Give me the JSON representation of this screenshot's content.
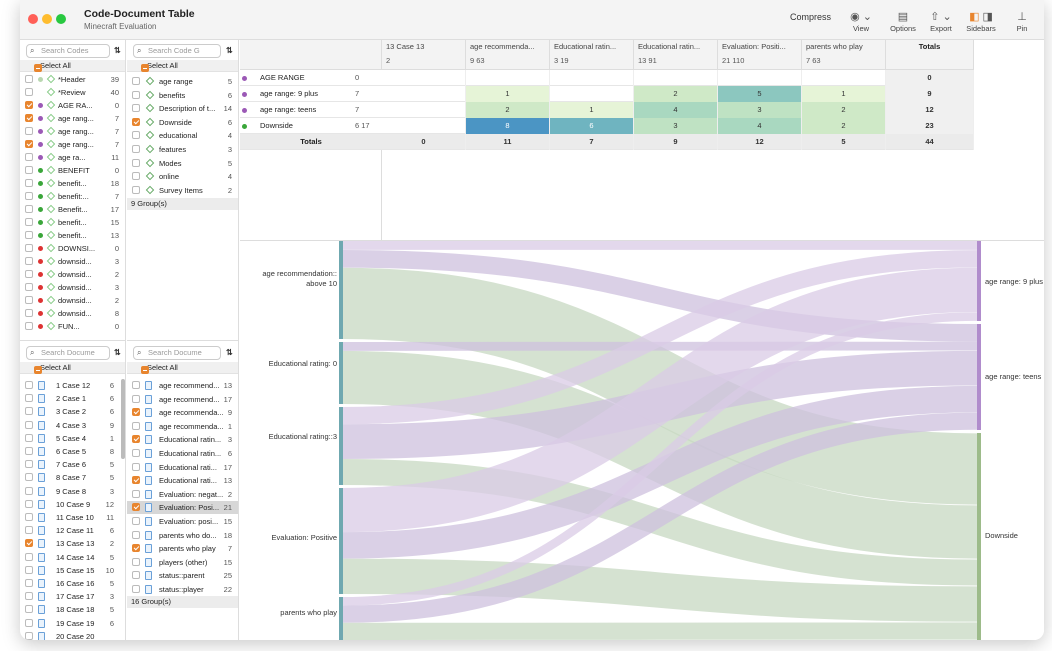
{
  "window": {
    "title": "Code-Document Table",
    "subtitle": "Minecraft Evaluation"
  },
  "toolbar": {
    "compress": "Compress",
    "view": "View",
    "options": "Options",
    "export": "Export",
    "sidebars": "Sidebars",
    "pin": "Pin"
  },
  "codes_panel": {
    "search_placeholder": "Search Codes",
    "select_all": "Select All",
    "items": [
      {
        "label": "*Header",
        "count": "39",
        "color": "#b9d7b0",
        "checked": false
      },
      {
        "label": "*Review",
        "count": "40",
        "color": "",
        "checked": false
      },
      {
        "label": "AGE RA...",
        "count": "0",
        "color": "#9b59b6",
        "checked": true
      },
      {
        "label": "age rang...",
        "count": "7",
        "color": "#9b59b6",
        "checked": true
      },
      {
        "label": "age rang...",
        "count": "7",
        "color": "#9b59b6",
        "checked": false
      },
      {
        "label": "age rang...",
        "count": "7",
        "color": "#9b59b6",
        "checked": true
      },
      {
        "label": "age ra...",
        "count": "11",
        "color": "#9b59b6",
        "checked": false
      },
      {
        "label": "BENEFIT",
        "count": "0",
        "color": "#3aa63a",
        "checked": false
      },
      {
        "label": "benefit...",
        "count": "18",
        "color": "#3aa63a",
        "checked": false
      },
      {
        "label": "benefit:...",
        "count": "7",
        "color": "#3aa63a",
        "checked": false
      },
      {
        "label": "Benefit...",
        "count": "17",
        "color": "#3aa63a",
        "checked": false
      },
      {
        "label": "benefit...",
        "count": "15",
        "color": "#3aa63a",
        "checked": false
      },
      {
        "label": "benefit...",
        "count": "13",
        "color": "#3aa63a",
        "checked": false
      },
      {
        "label": "DOWNSI...",
        "count": "0",
        "color": "#d33",
        "checked": false
      },
      {
        "label": "downsid...",
        "count": "3",
        "color": "#d33",
        "checked": false
      },
      {
        "label": "downsid...",
        "count": "2",
        "color": "#d33",
        "checked": false
      },
      {
        "label": "downsid...",
        "count": "3",
        "color": "#d33",
        "checked": false
      },
      {
        "label": "downsid...",
        "count": "2",
        "color": "#d33",
        "checked": false
      },
      {
        "label": "downsid...",
        "count": "8",
        "color": "#d33",
        "checked": false
      },
      {
        "label": "FUN...",
        "count": "0",
        "color": "#d33",
        "checked": false
      }
    ]
  },
  "code_groups_panel": {
    "search_placeholder": "Search Code G",
    "select_all": "Select All",
    "items": [
      {
        "label": "age range",
        "count": "5",
        "checked": false
      },
      {
        "label": "benefits",
        "count": "6",
        "checked": false
      },
      {
        "label": "Description of t...",
        "count": "14",
        "checked": false
      },
      {
        "label": "Downside",
        "count": "6",
        "checked": true
      },
      {
        "label": "educational",
        "count": "4",
        "checked": false
      },
      {
        "label": "features",
        "count": "3",
        "checked": false
      },
      {
        "label": "Modes",
        "count": "5",
        "checked": false
      },
      {
        "label": "online",
        "count": "4",
        "checked": false
      },
      {
        "label": "Survey Items",
        "count": "2",
        "checked": false
      }
    ],
    "footer": "9 Group(s)"
  },
  "documents_panel": {
    "search_placeholder": "Search Docume",
    "select_all": "Select All",
    "items": [
      {
        "label": "1 Case 12",
        "count": "6",
        "checked": false
      },
      {
        "label": "2 Case 1",
        "count": "6",
        "checked": false
      },
      {
        "label": "3 Case 2",
        "count": "6",
        "checked": false
      },
      {
        "label": "4 Case 3",
        "count": "9",
        "checked": false
      },
      {
        "label": "5 Case 4",
        "count": "1",
        "checked": false
      },
      {
        "label": "6 Case 5",
        "count": "8",
        "checked": false
      },
      {
        "label": "7 Case 6",
        "count": "5",
        "checked": false
      },
      {
        "label": "8 Case 7",
        "count": "5",
        "checked": false
      },
      {
        "label": "9 Case 8",
        "count": "3",
        "checked": false
      },
      {
        "label": "10 Case 9",
        "count": "12",
        "checked": false
      },
      {
        "label": "11 Case 10",
        "count": "11",
        "checked": false
      },
      {
        "label": "12 Case 11",
        "count": "6",
        "checked": false
      },
      {
        "label": "13 Case 13",
        "count": "2",
        "checked": true
      },
      {
        "label": "14 Case 14",
        "count": "5",
        "checked": false
      },
      {
        "label": "15 Case 15",
        "count": "10",
        "checked": false
      },
      {
        "label": "16 Case 16",
        "count": "5",
        "checked": false
      },
      {
        "label": "17 Case 17",
        "count": "3",
        "checked": false
      },
      {
        "label": "18 Case 18",
        "count": "5",
        "checked": false
      },
      {
        "label": "19 Case 19",
        "count": "6",
        "checked": false
      },
      {
        "label": "20 Case 20",
        "count": "",
        "checked": false
      }
    ]
  },
  "doc_groups_panel": {
    "search_placeholder": "Search Docume",
    "select_all": "Select All",
    "items": [
      {
        "label": "age recommend...",
        "count": "13",
        "checked": false
      },
      {
        "label": "age recommend...",
        "count": "17",
        "checked": false
      },
      {
        "label": "age recommenda...",
        "count": "9",
        "checked": true
      },
      {
        "label": "age recommenda...",
        "count": "1",
        "checked": false
      },
      {
        "label": "Educational ratin...",
        "count": "3",
        "checked": true
      },
      {
        "label": "Educational ratin...",
        "count": "6",
        "checked": false
      },
      {
        "label": "Educational rati...",
        "count": "17",
        "checked": false
      },
      {
        "label": "Educational rati...",
        "count": "13",
        "checked": true
      },
      {
        "label": "Evaluation: negat...",
        "count": "2",
        "checked": false
      },
      {
        "label": "Evaluation: Posi...",
        "count": "21",
        "checked": true,
        "selected": true
      },
      {
        "label": "Evaluation: posi...",
        "count": "15",
        "checked": false
      },
      {
        "label": "parents who do...",
        "count": "18",
        "checked": false
      },
      {
        "label": "parents who play",
        "count": "7",
        "checked": true
      },
      {
        "label": "players (other)",
        "count": "15",
        "checked": false
      },
      {
        "label": "status::parent",
        "count": "25",
        "checked": false
      },
      {
        "label": "status::player",
        "count": "22",
        "checked": false
      }
    ],
    "footer": "16 Group(s)"
  },
  "matrix": {
    "columns": [
      {
        "name": "13  Case 13",
        "meta": "2",
        "type": "doc"
      },
      {
        "name": "age recommenda...",
        "meta": "9   63",
        "type": "group"
      },
      {
        "name": "Educational ratin...",
        "meta": "3   19",
        "type": "group"
      },
      {
        "name": "Educational ratin...",
        "meta": "13   91",
        "type": "group"
      },
      {
        "name": "Evaluation: Positi...",
        "meta": "21   110",
        "type": "group"
      },
      {
        "name": "parents who play",
        "meta": "7   63",
        "type": "group"
      },
      {
        "name": "Totals",
        "meta": "",
        "type": "total"
      }
    ],
    "rows": [
      {
        "label": "AGE RANGE",
        "meta": "0",
        "color": "#9b59b6",
        "cells": [
          "",
          "",
          "",
          "",
          "",
          "",
          ""
        ],
        "total": "0"
      },
      {
        "label": "age range: 9 plus",
        "meta": "7",
        "color": "#9b59b6",
        "cells": [
          "",
          "1",
          "",
          "2",
          "5",
          "1"
        ],
        "total": "9"
      },
      {
        "label": "age range: teens",
        "meta": "7",
        "color": "#9b59b6",
        "cells": [
          "",
          "2",
          "1",
          "4",
          "3",
          "2"
        ],
        "total": "12"
      },
      {
        "label": "Downside",
        "meta": "6   17",
        "color": "#3aa63a",
        "cells": [
          "",
          "8",
          "6",
          "3",
          "4",
          "2"
        ],
        "total": "23"
      }
    ],
    "totals": {
      "label": "Totals",
      "cells": [
        "0",
        "11",
        "7",
        "9",
        "12",
        "5"
      ],
      "total": "44"
    }
  },
  "sankey": {
    "left": [
      "age recommendation:: above 10",
      "Educational rating: 0",
      "Educational rating::3",
      "Evaluation: Positive",
      "parents who play"
    ],
    "right": [
      "age range: 9 plus",
      "age range: teens",
      "Downside"
    ],
    "flows": [
      [
        1,
        2,
        8
      ],
      [
        0,
        1,
        6
      ],
      [
        2,
        4,
        3
      ],
      [
        5,
        3,
        4
      ],
      [
        1,
        2,
        2
      ]
    ]
  }
}
